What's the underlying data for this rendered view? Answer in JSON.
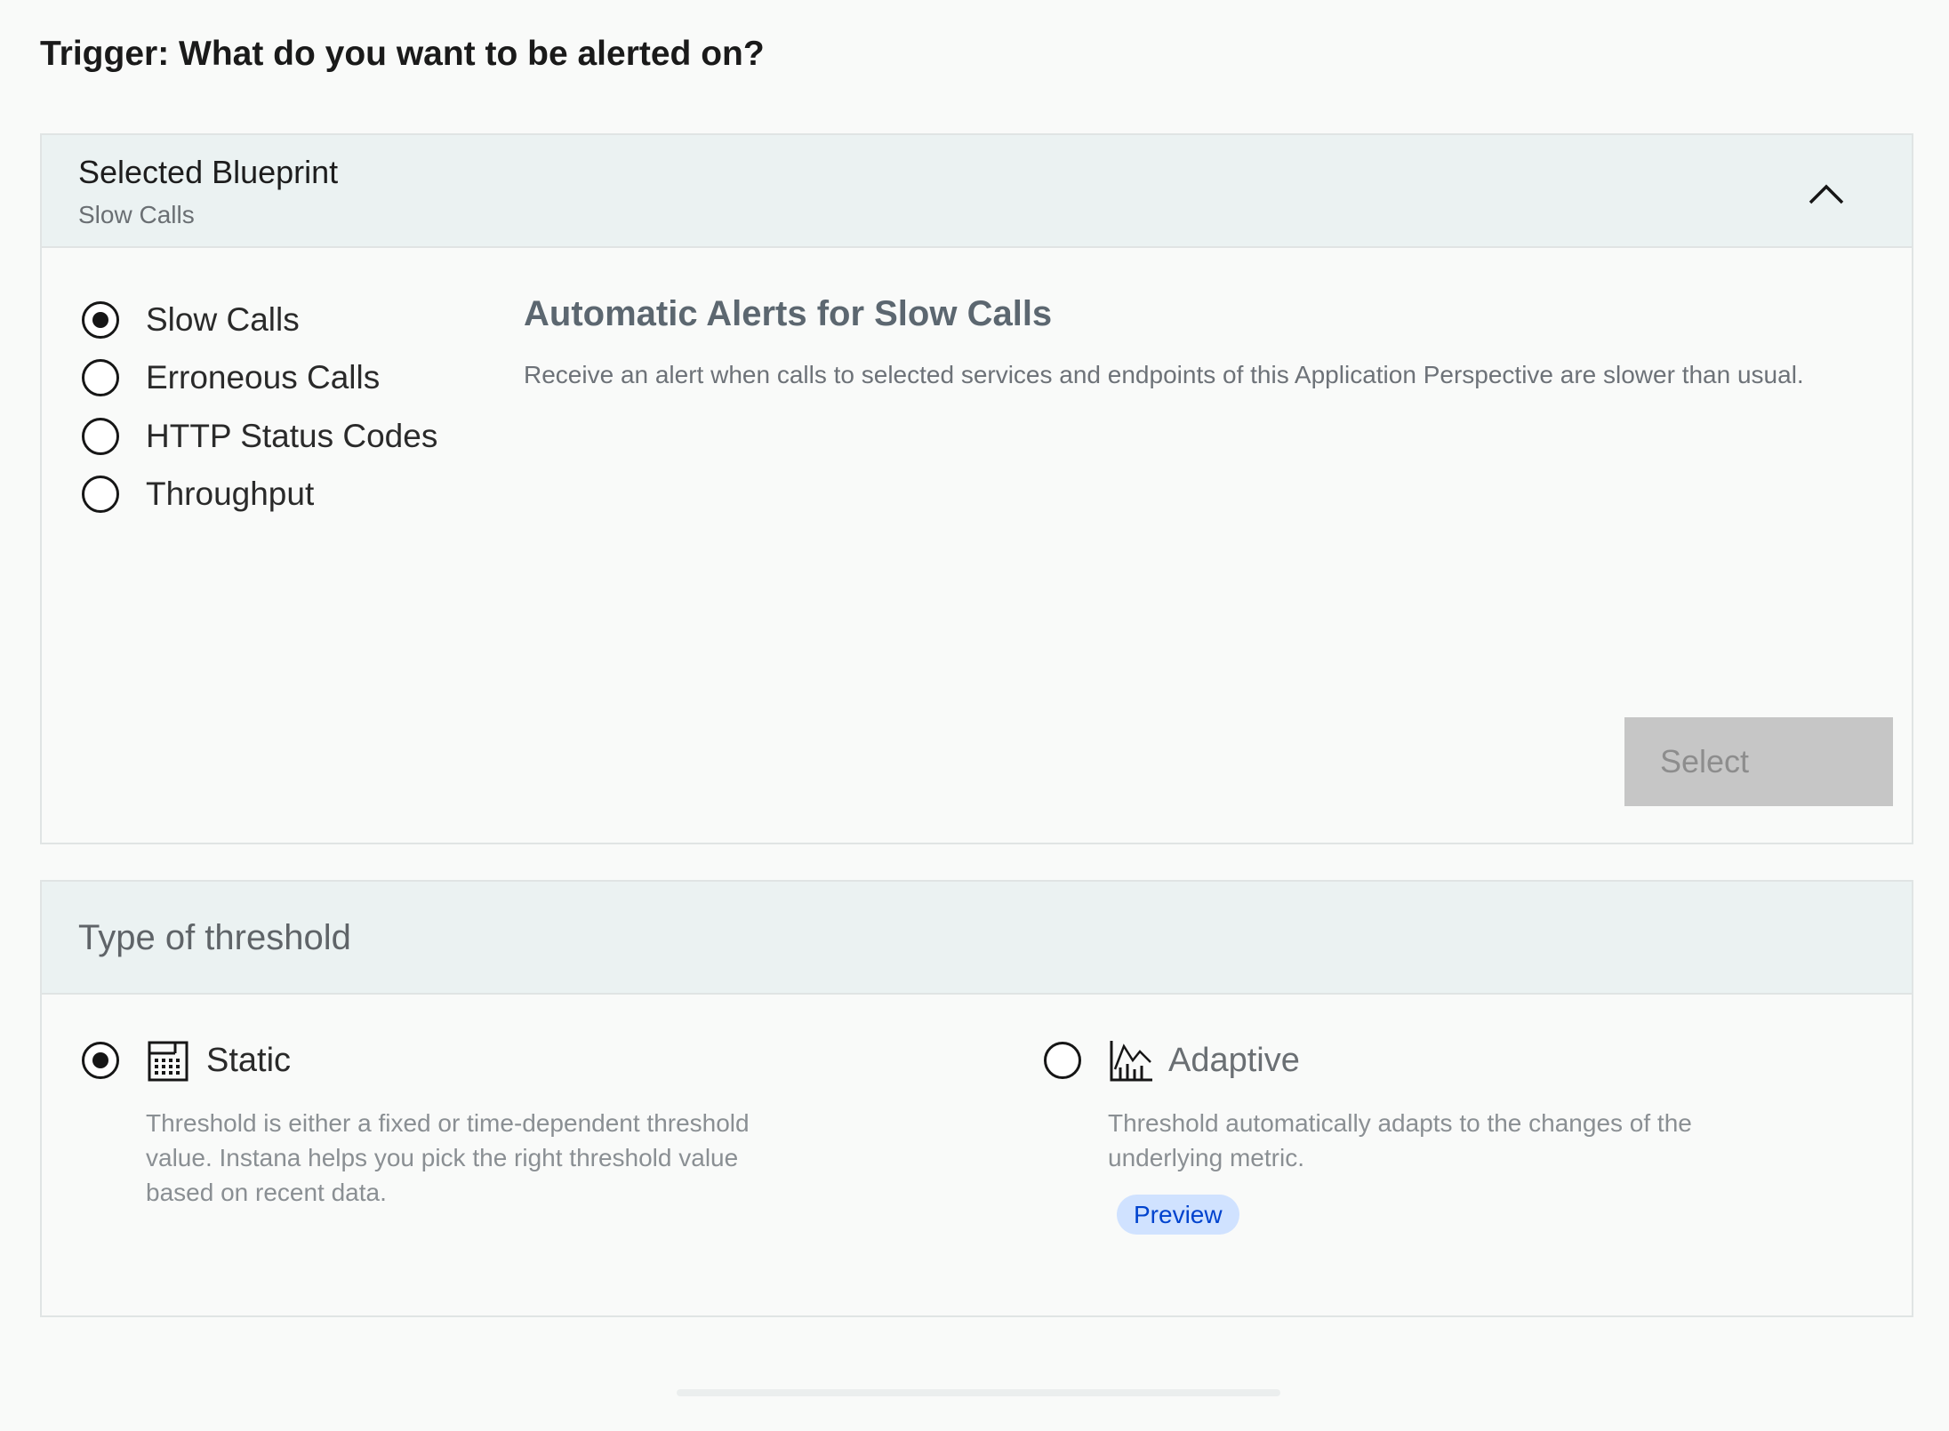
{
  "page": {
    "title": "Trigger: What do you want to be alerted on?"
  },
  "blueprint": {
    "header_title": "Selected Blueprint",
    "header_subtitle": "Slow Calls",
    "toggle_icon": "chevron-up-icon",
    "options": [
      {
        "label": "Slow Calls",
        "checked": true
      },
      {
        "label": "Erroneous Calls",
        "checked": false
      },
      {
        "label": "HTTP Status Codes",
        "checked": false
      },
      {
        "label": "Throughput",
        "checked": false
      }
    ],
    "detail_title": "Automatic Alerts for Slow Calls",
    "detail_description": "Receive an alert when calls to selected services and endpoints of this Application Perspective are slower than usual.",
    "select_label": "Select",
    "select_enabled": false
  },
  "threshold": {
    "title": "Type of threshold",
    "static": {
      "label": "Static",
      "icon": "static-threshold-icon",
      "checked": true,
      "description": "Threshold is either a fixed or time-dependent threshold value. Instana helps you pick the right threshold value based on recent data."
    },
    "adaptive": {
      "label": "Adaptive",
      "icon": "adaptive-threshold-icon",
      "checked": false,
      "description": "Threshold automatically adapts to the changes of the underlying metric.",
      "tag": "Preview"
    }
  },
  "colors": {
    "background": "#f9faf9",
    "header_background": "#ebf2f2",
    "border": "#e0e4e4",
    "disabled_button": "#c6c6c6",
    "tag_background": "#d0e2ff",
    "tag_text": "#0043ce"
  }
}
